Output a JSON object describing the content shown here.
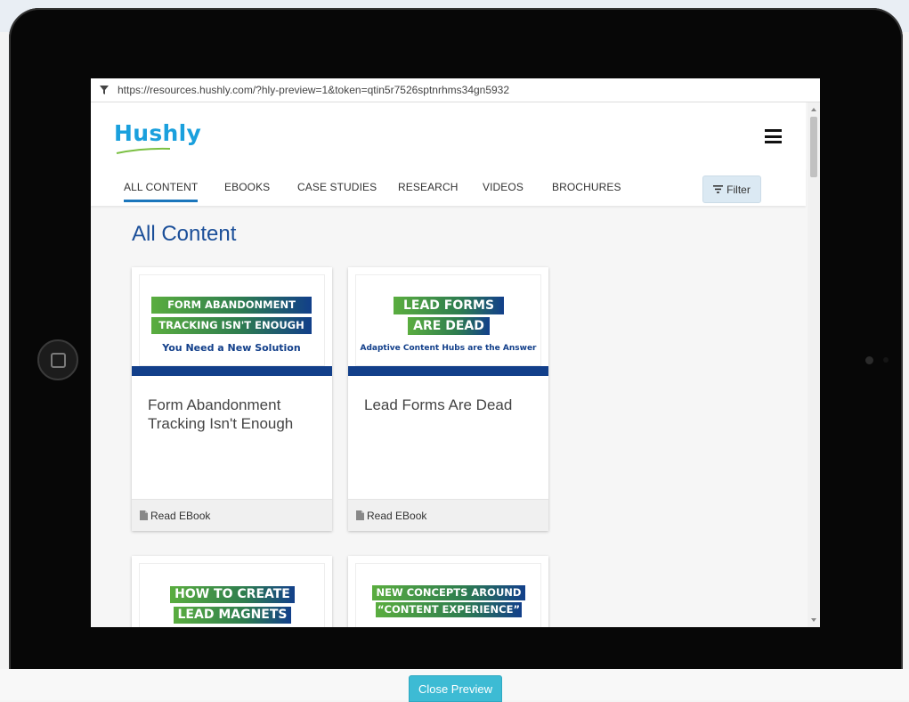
{
  "browser": {
    "url": "https://resources.hushly.com/?hly-preview=1&token=qtin5r7526sptnrhms34gn5932"
  },
  "site": {
    "logo_text": "Hushly"
  },
  "nav": {
    "tabs": [
      {
        "label": "ALL CONTENT",
        "active": true
      },
      {
        "label": "EBOOKS",
        "active": false
      },
      {
        "label": "CASE STUDIES",
        "active": false
      },
      {
        "label": "RESEARCH",
        "active": false
      },
      {
        "label": "VIDEOS",
        "active": false
      },
      {
        "label": "BROCHURES",
        "active": false
      }
    ],
    "filter_label": "Filter"
  },
  "main": {
    "heading": "All Content",
    "cards": [
      {
        "thumb_lines": [
          "FORM ABANDONMENT",
          "TRACKING ISN'T ENOUGH",
          "You Need a New Solution"
        ],
        "title": "Form Abandonment Tracking Isn't Enough",
        "cta": "Read EBook"
      },
      {
        "thumb_lines": [
          "LEAD FORMS",
          "ARE DEAD",
          "Adaptive Content Hubs are the Answer"
        ],
        "title": "Lead Forms Are Dead",
        "cta": "Read EBook"
      },
      {
        "thumb_lines": [
          "HOW TO CREATE",
          "LEAD MAGNETS"
        ]
      },
      {
        "thumb_lines": [
          "NEW CONCEPTS AROUND",
          "“CONTENT EXPERIENCE”"
        ]
      }
    ]
  },
  "footer": {
    "close_label": "Close Preview"
  },
  "colors": {
    "brand_blue": "#1aa0dd",
    "heading_blue": "#1b4f99",
    "banner_blue": "#123f8a",
    "banner_green": "#5aad3f",
    "close_button": "#3dbbd4"
  }
}
